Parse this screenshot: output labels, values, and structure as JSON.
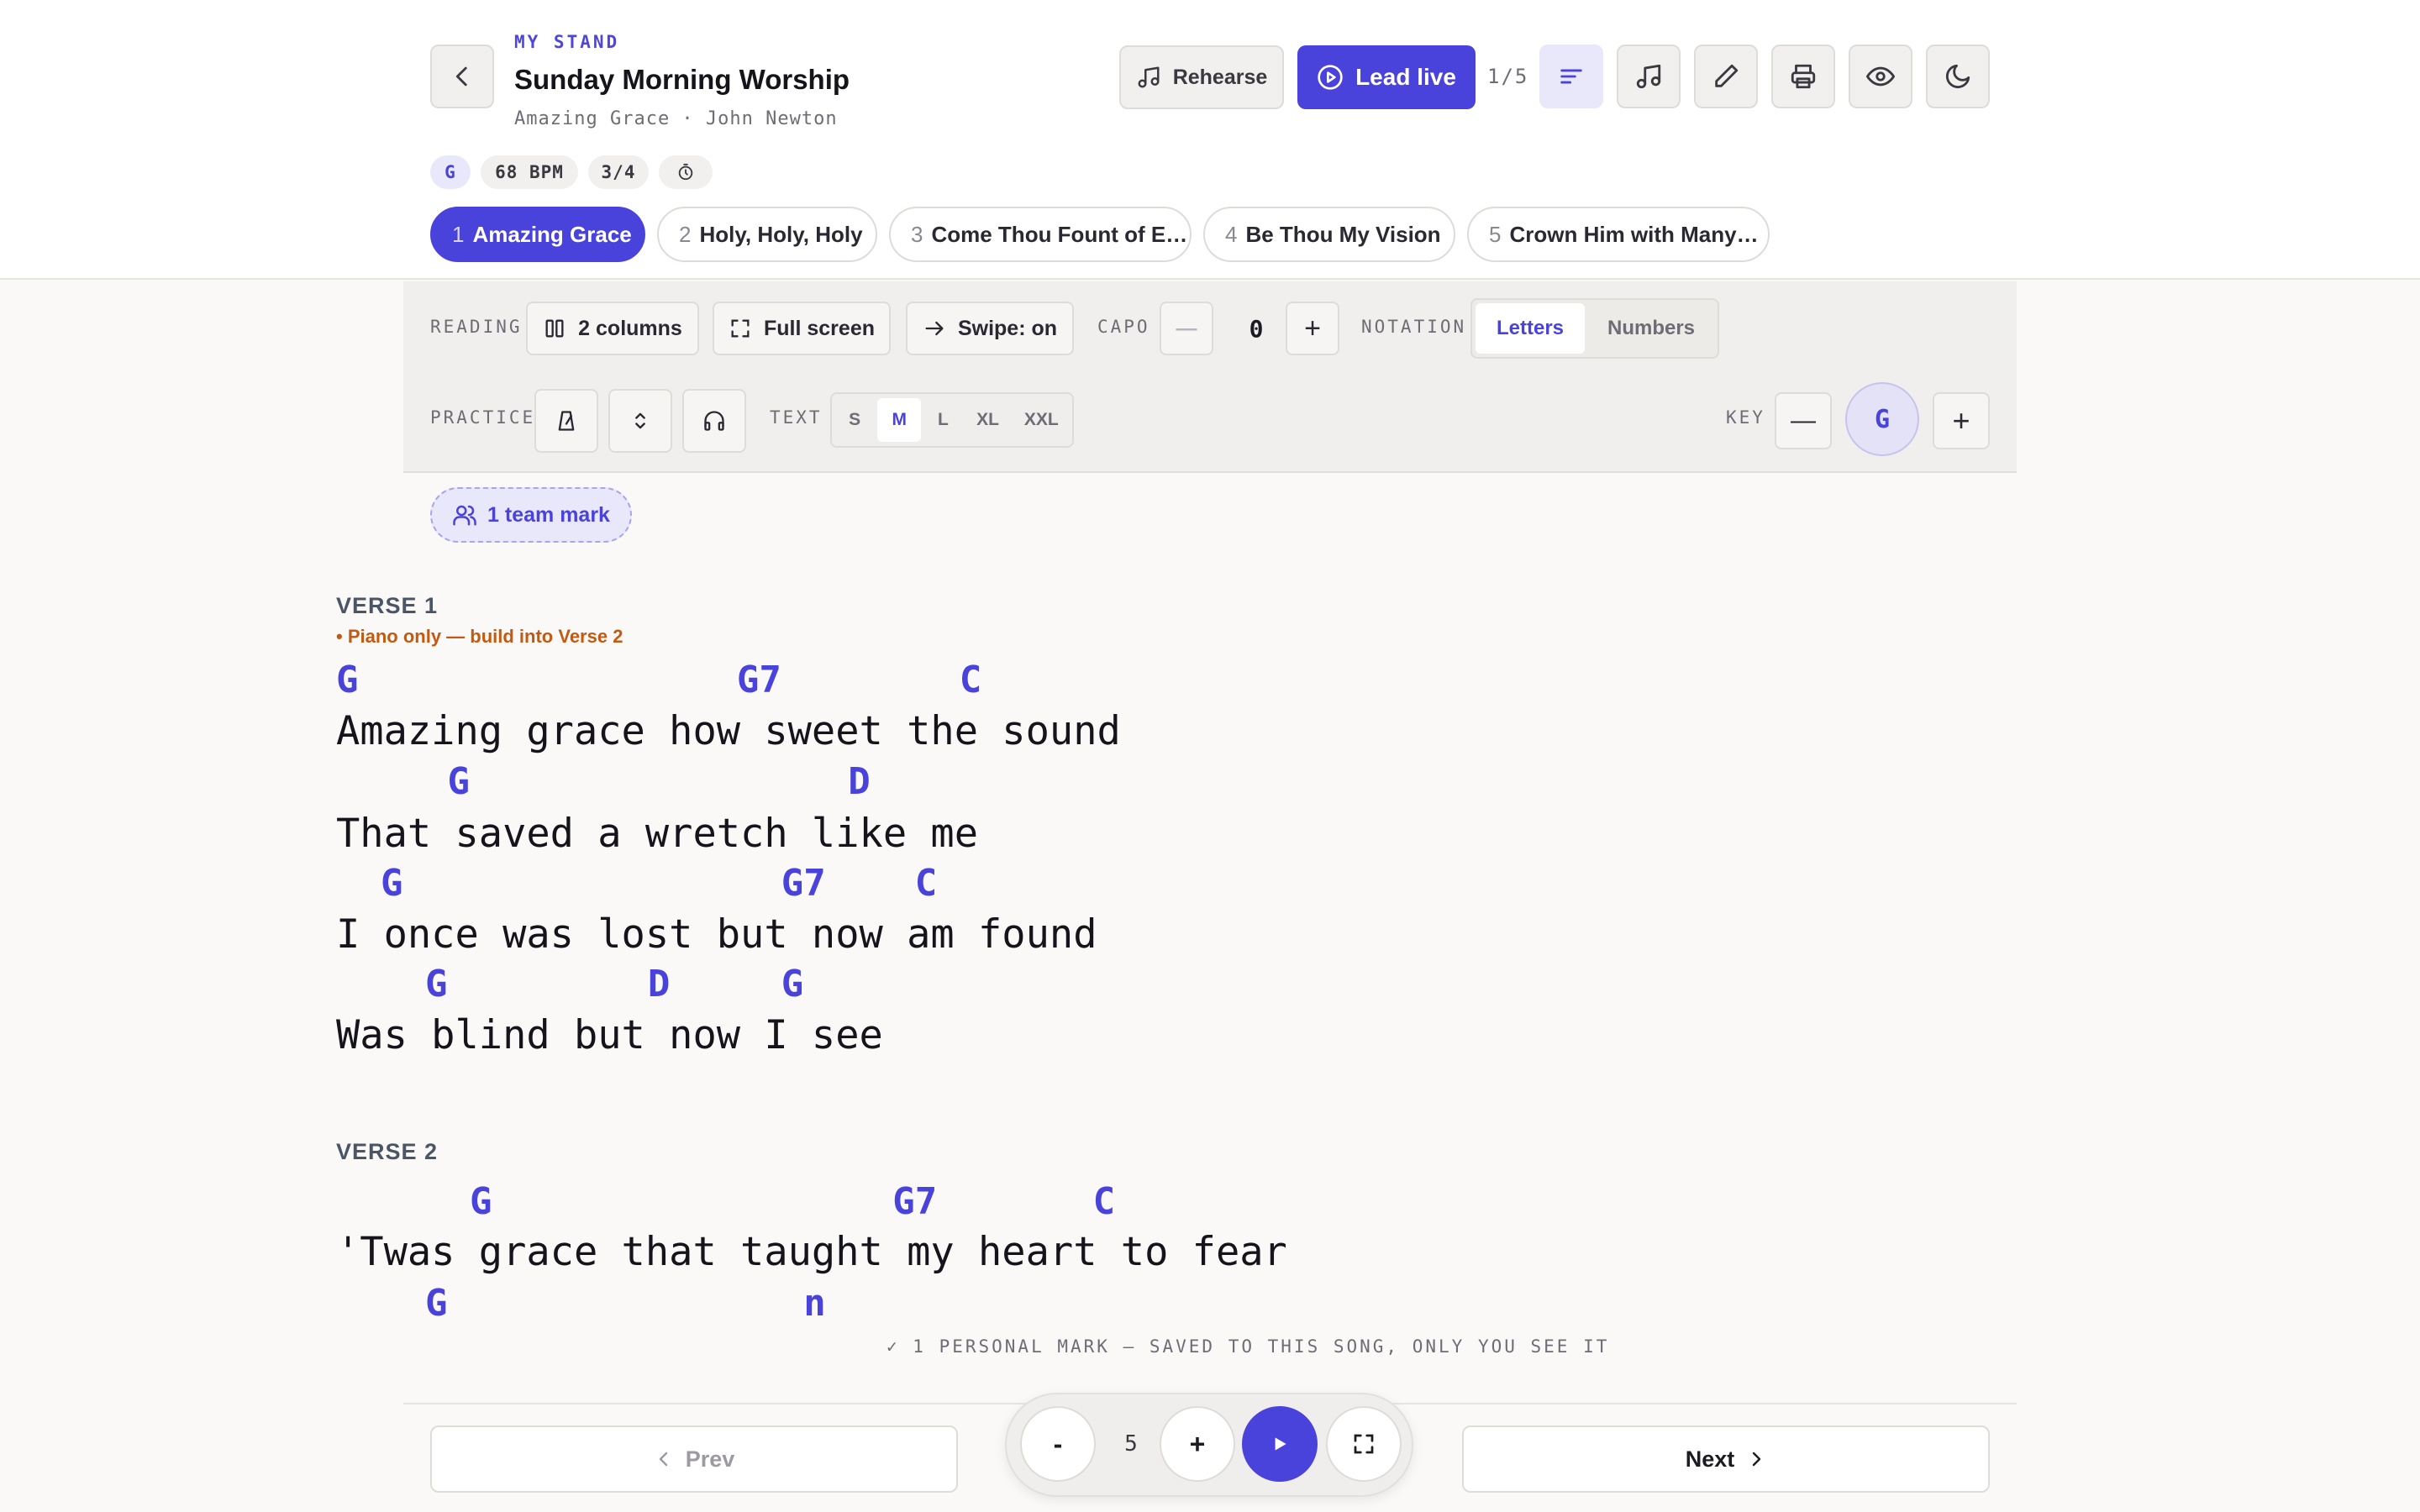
{
  "header": {
    "eyebrow": "MY STAND",
    "title": "Sunday Morning Worship",
    "subtitle": "Amazing Grace · John Newton",
    "rehearse_label": "Rehearse",
    "lead_label": "Lead live",
    "position": "1/5",
    "meta": {
      "key": "G",
      "bpm": "68 BPM",
      "time": "3/4"
    },
    "icons": [
      "chevron-left-icon",
      "music-note-icon",
      "play-circle-icon",
      "list-icon",
      "music-note-icon",
      "pencil-icon",
      "printer-icon",
      "eye-icon",
      "moon-icon",
      "timer-icon"
    ]
  },
  "songs": [
    {
      "num": "1",
      "title": "Amazing Grace",
      "active": true
    },
    {
      "num": "2",
      "title": "Holy, Holy, Holy"
    },
    {
      "num": "3",
      "title": "Come Thou Fount of E…"
    },
    {
      "num": "4",
      "title": "Be Thou My Vision"
    },
    {
      "num": "5",
      "title": "Crown Him with Many…"
    }
  ],
  "toolbar": {
    "reading_label": "READING",
    "columns_label": "2 columns",
    "fullscreen_label": "Full screen",
    "swipe_label": "Swipe: on",
    "capo_label": "CAPO",
    "capo_minus": "—",
    "capo_value": "0",
    "capo_plus": "+",
    "notation_label": "NOTATION",
    "notation_options": [
      "Letters",
      "Numbers"
    ],
    "notation_selected": "Letters",
    "practice_label": "PRACTICE",
    "text_label": "TEXT",
    "text_sizes": [
      "S",
      "M",
      "L",
      "XL",
      "XXL"
    ],
    "text_selected": "M",
    "key_label": "KEY",
    "key_minus": "—",
    "key_value": "G",
    "key_plus": "+"
  },
  "team_mark": "1 team mark",
  "song": {
    "sections": [
      {
        "label": "VERSE 1",
        "note": "• Piano only — build into Verse 2",
        "lines": [
          {
            "chords": "G                 G7        C",
            "lyric": "Amazing grace how sweet the sound"
          },
          {
            "chords": "     G                 D",
            "lyric": "That saved a wretch like me"
          },
          {
            "chords": "  G                 G7    C",
            "lyric": "I once was lost but now am found"
          },
          {
            "chords": "    G         D     G",
            "lyric": "Was blind but now I see"
          }
        ]
      },
      {
        "label": "VERSE 2",
        "note": "",
        "lines": [
          {
            "chords": "      G                  G7       C",
            "lyric": "'Twas grace that taught my heart to fear"
          },
          {
            "chords": "    G                n",
            "lyric": ""
          }
        ]
      }
    ]
  },
  "personal_mark": "✓ 1 PERSONAL MARK — SAVED TO THIS SONG, ONLY YOU SEE IT",
  "footer": {
    "prev_label": "Prev",
    "next_label": "Next",
    "minus_label": "-",
    "speed_value": "5",
    "plus_label": "+"
  },
  "colors": {
    "accent": "#4a43db",
    "note": "#c25a12",
    "background": "#faf9f7"
  }
}
